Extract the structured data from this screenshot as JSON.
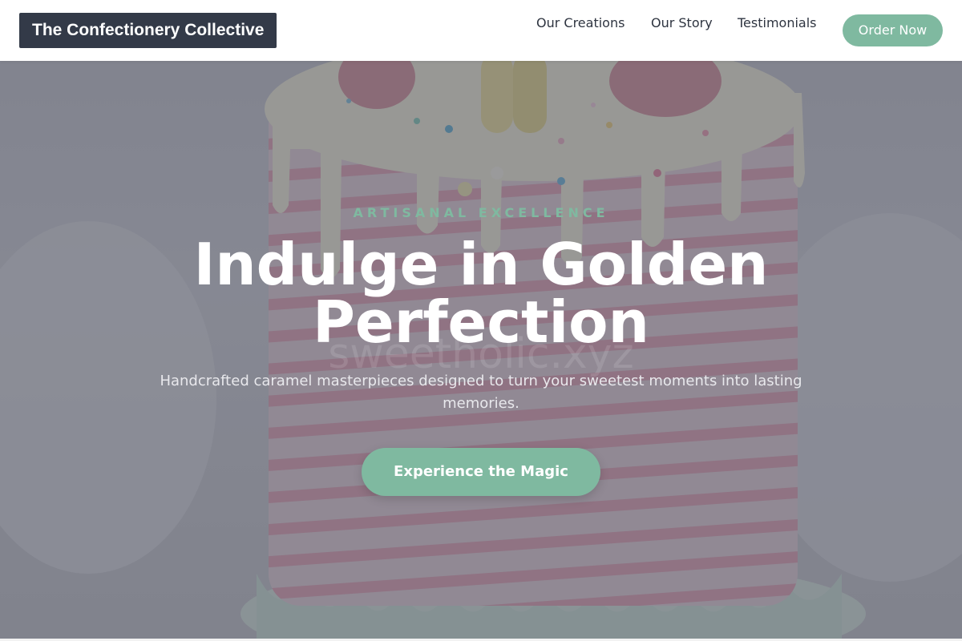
{
  "nav": {
    "logo": "The Confectionery Collective",
    "links": [
      "Our Creations",
      "Our Story",
      "Testimonials"
    ],
    "cta": "Order Now"
  },
  "hero": {
    "eyebrow": "ARTISANAL EXCELLENCE",
    "headline": "Indulge in Golden Perfection",
    "subtext": "Handcrafted caramel masterpieces designed to turn your sweetest moments into lasting memories.",
    "watermark": "sweetholic.xyz",
    "cta": "Experience the Magic",
    "image_subject": "pink-striped drip cake with macarons"
  },
  "colors": {
    "accent": "#7fb9a0",
    "logo_bg": "#333a48",
    "nav_text": "#2e3440",
    "overlay": "#343846"
  }
}
